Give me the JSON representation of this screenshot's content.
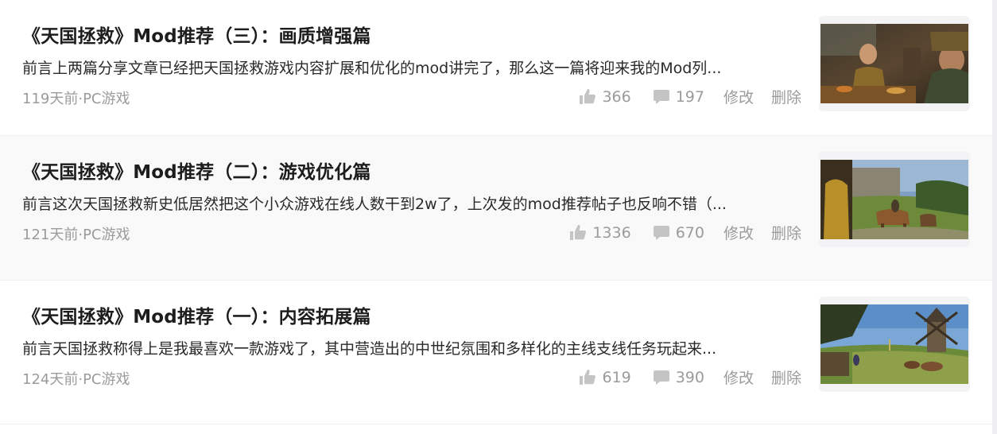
{
  "posts": [
    {
      "title": "《天国拯救》Mod推荐（三）：画质增强篇",
      "excerpt": "前言上两篇分享文章已经把天国拯救游戏内容扩展和优化的mod讲完了，那么这一篇将迎来我的Mod列...",
      "meta": "119天前·PC游戏",
      "likes": "366",
      "comments": "197",
      "edit_label": "修改",
      "delete_label": "删除"
    },
    {
      "title": "《天国拯救》Mod推荐（二）：游戏优化篇",
      "excerpt": "前言这次天国拯救新史低居然把这个小众游戏在线人数干到2w了，上次发的mod推荐帖子也反响不错（...",
      "meta": "121天前·PC游戏",
      "likes": "1336",
      "comments": "670",
      "edit_label": "修改",
      "delete_label": "删除"
    },
    {
      "title": "《天国拯救》Mod推荐（一）：内容拓展篇",
      "excerpt": "前言天国拯救称得上是我最喜欢一款游戏了，其中营造出的中世纪氛围和多样化的主线支线任务玩起来...",
      "meta": "124天前·PC游戏",
      "likes": "619",
      "comments": "390",
      "edit_label": "修改",
      "delete_label": "删除"
    }
  ],
  "icons": {
    "like": "thumbs-up-icon",
    "comment": "comment-icon"
  },
  "colors": {
    "muted": "#9b9b9b",
    "title": "#1d1d1d",
    "alt_row": "#f9f9fa"
  }
}
